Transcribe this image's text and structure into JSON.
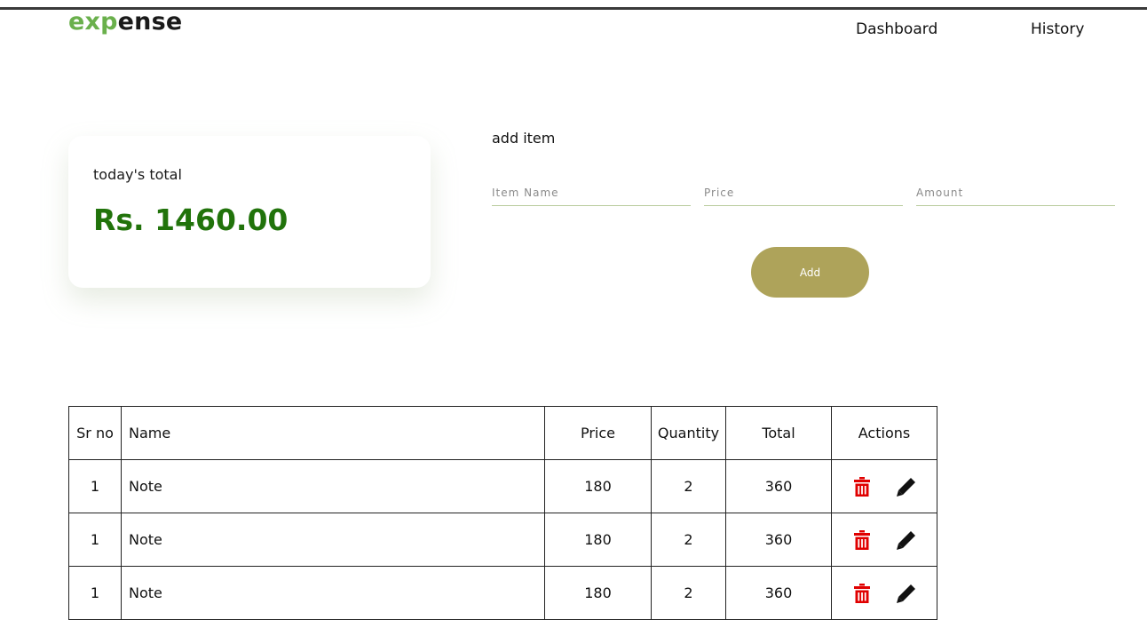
{
  "brand": {
    "part1": "exp",
    "part2": "ense"
  },
  "nav": {
    "dashboard": "Dashboard",
    "history": "History"
  },
  "summary": {
    "label": "today's total",
    "amount": "Rs. 1460.00"
  },
  "add_item": {
    "title": "add item",
    "item_placeholder": "Item Name",
    "price_placeholder": "Price",
    "amount_placeholder": "Amount",
    "add_label": "Add"
  },
  "table": {
    "headers": [
      "Sr no",
      "Name",
      "Price",
      "Quantity",
      "Total",
      "Actions"
    ],
    "rows": [
      {
        "sr": "1",
        "name": "Note",
        "price": "180",
        "qty": "2",
        "total": "360"
      },
      {
        "sr": "1",
        "name": "Note",
        "price": "180",
        "qty": "2",
        "total": "360"
      },
      {
        "sr": "1",
        "name": "Note",
        "price": "180",
        "qty": "2",
        "total": "360"
      }
    ]
  },
  "icons": {
    "delete": "trash-icon",
    "edit": "pencil-icon"
  },
  "colors": {
    "brand_green": "#6ab04c",
    "total_green": "#21730b",
    "button": "#aea35a",
    "delete_red": "#e00000"
  }
}
